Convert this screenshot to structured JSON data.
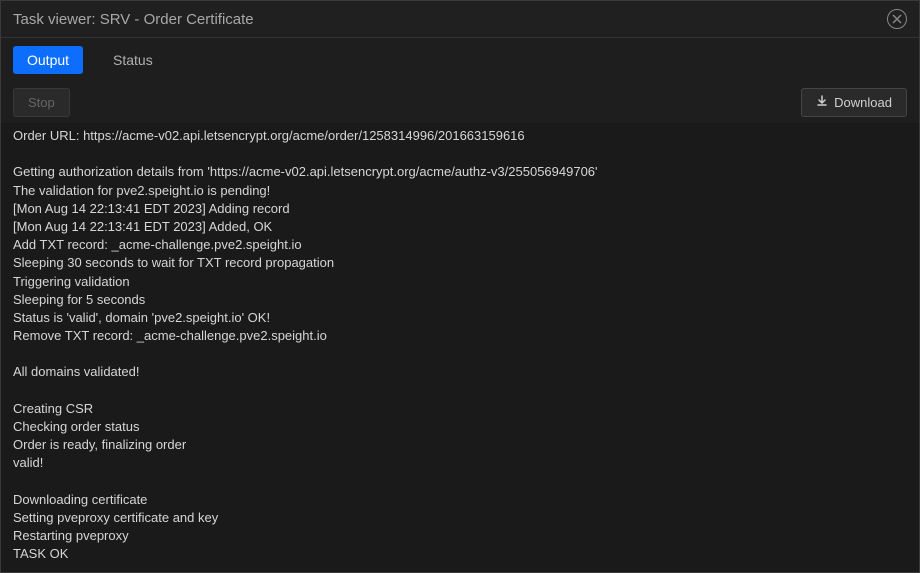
{
  "title": "Task viewer: SRV - Order Certificate",
  "tabs": {
    "output": "Output",
    "status": "Status"
  },
  "toolbar": {
    "stop": "Stop",
    "download": "Download"
  },
  "icons": {
    "close": "✕",
    "download": "⬇"
  },
  "output_text": "Order URL: https://acme-v02.api.letsencrypt.org/acme/order/1258314996/201663159616\n\nGetting authorization details from 'https://acme-v02.api.letsencrypt.org/acme/authz-v3/255056949706'\nThe validation for pve2.speight.io is pending!\n[Mon Aug 14 22:13:41 EDT 2023] Adding record\n[Mon Aug 14 22:13:41 EDT 2023] Added, OK\nAdd TXT record: _acme-challenge.pve2.speight.io\nSleeping 30 seconds to wait for TXT record propagation\nTriggering validation\nSleeping for 5 seconds\nStatus is 'valid', domain 'pve2.speight.io' OK!\nRemove TXT record: _acme-challenge.pve2.speight.io\n\nAll domains validated!\n\nCreating CSR\nChecking order status\nOrder is ready, finalizing order\nvalid!\n\nDownloading certificate\nSetting pveproxy certificate and key\nRestarting pveproxy\nTASK OK"
}
